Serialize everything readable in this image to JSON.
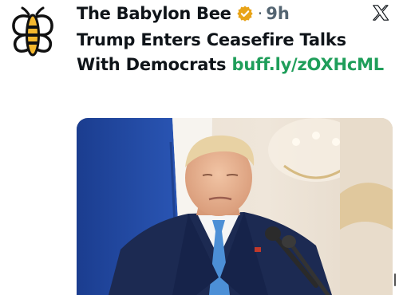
{
  "tweet": {
    "author_name": "The Babylon Bee",
    "separator": "·",
    "timestamp": "9h",
    "text": "Trump Enters Ceasefire Talks With Democrats",
    "link": "buff.ly/zOXHcML"
  },
  "icons": {
    "avatar": "babylon-bee-logo",
    "verified": "verified-badge",
    "platform": "x-logo"
  },
  "colors": {
    "link": "#1f9e5a",
    "badge": "#e8a317",
    "logo_yellow": "#f4b82e",
    "text": "#0f1419",
    "muted": "#536471"
  }
}
